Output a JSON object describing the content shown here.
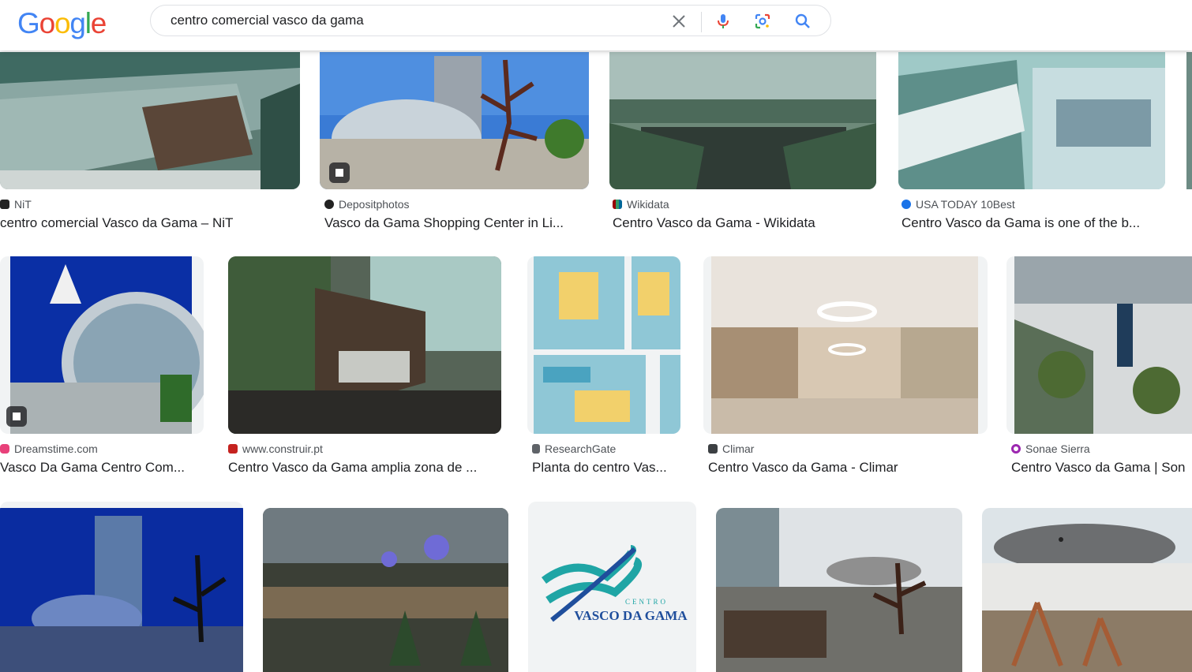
{
  "header": {
    "logo_letters": [
      {
        "ch": "G",
        "color": "#4285F4"
      },
      {
        "ch": "o",
        "color": "#EA4335"
      },
      {
        "ch": "o",
        "color": "#FBBC05"
      },
      {
        "ch": "g",
        "color": "#4285F4"
      },
      {
        "ch": "l",
        "color": "#34A853"
      },
      {
        "ch": "e",
        "color": "#EA4335"
      }
    ],
    "search_query": "centro comercial vasco da gama",
    "icons": [
      "close-icon",
      "microphone-icon",
      "lens-icon",
      "search-icon"
    ]
  },
  "results": [
    {
      "source": "NiT",
      "title": "centro comercial Vasco da Gama – NiT",
      "fav": "#222222"
    },
    {
      "source": "Depositphotos",
      "title": "Vasco da Gama Shopping Center in Li...",
      "fav": "#222222"
    },
    {
      "source": "Wikidata",
      "title": "Centro Vasco da Gama - Wikidata",
      "fav": "#990000"
    },
    {
      "source": "USA TODAY 10Best",
      "title": "Centro Vasco da Gama is one of the b...",
      "fav": "#1a73e8"
    },
    {
      "source": "Dreamstime.com",
      "title": "Vasco Da Gama Centro Com...",
      "fav": "#e8417a"
    },
    {
      "source": "www.construir.pt",
      "title": "Centro Vasco da Gama amplia zona de ...",
      "fav": "#c5221f"
    },
    {
      "source": "ResearchGate",
      "title": "Planta do centro Vas...",
      "fav": "#5f6368"
    },
    {
      "source": "Climar",
      "title": "Centro Vasco da Gama - Climar",
      "fav": "#3c4043"
    },
    {
      "source": "Sonae Sierra",
      "title": "Centro Vasco da Gama | Son",
      "fav": "#9c27b0"
    }
  ],
  "logo_image": {
    "line1": "CENTRO",
    "line2": "VASCO DA GAMA"
  }
}
